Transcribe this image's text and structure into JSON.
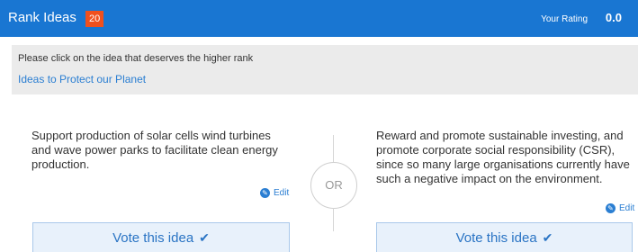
{
  "header": {
    "title": "Rank Ideas",
    "count": "20",
    "rating_label": "Your Rating",
    "rating_value": "0.0",
    "background_color": "#1976d2",
    "badge_color": "#f0501e"
  },
  "instructions": {
    "message": "Please click on the idea that deserves the higher rank",
    "topic": "Ideas to Protect our Planet"
  },
  "ideas": [
    {
      "text": "Support production of solar cells wind turbines and wave power parks to facilitate clean energy production.",
      "edit_label": "Edit",
      "vote_label": "Vote this idea"
    },
    {
      "text": "Reward and promote sustainable investing, and promote corporate social responsibility (CSR), since so many large organisations currently have such a negative impact on the environment.",
      "edit_label": "Edit",
      "vote_label": "Vote this idea"
    }
  ],
  "separator_label": "OR",
  "icons": {
    "edit": "pencil-icon",
    "vote": "checkmark-icon"
  }
}
